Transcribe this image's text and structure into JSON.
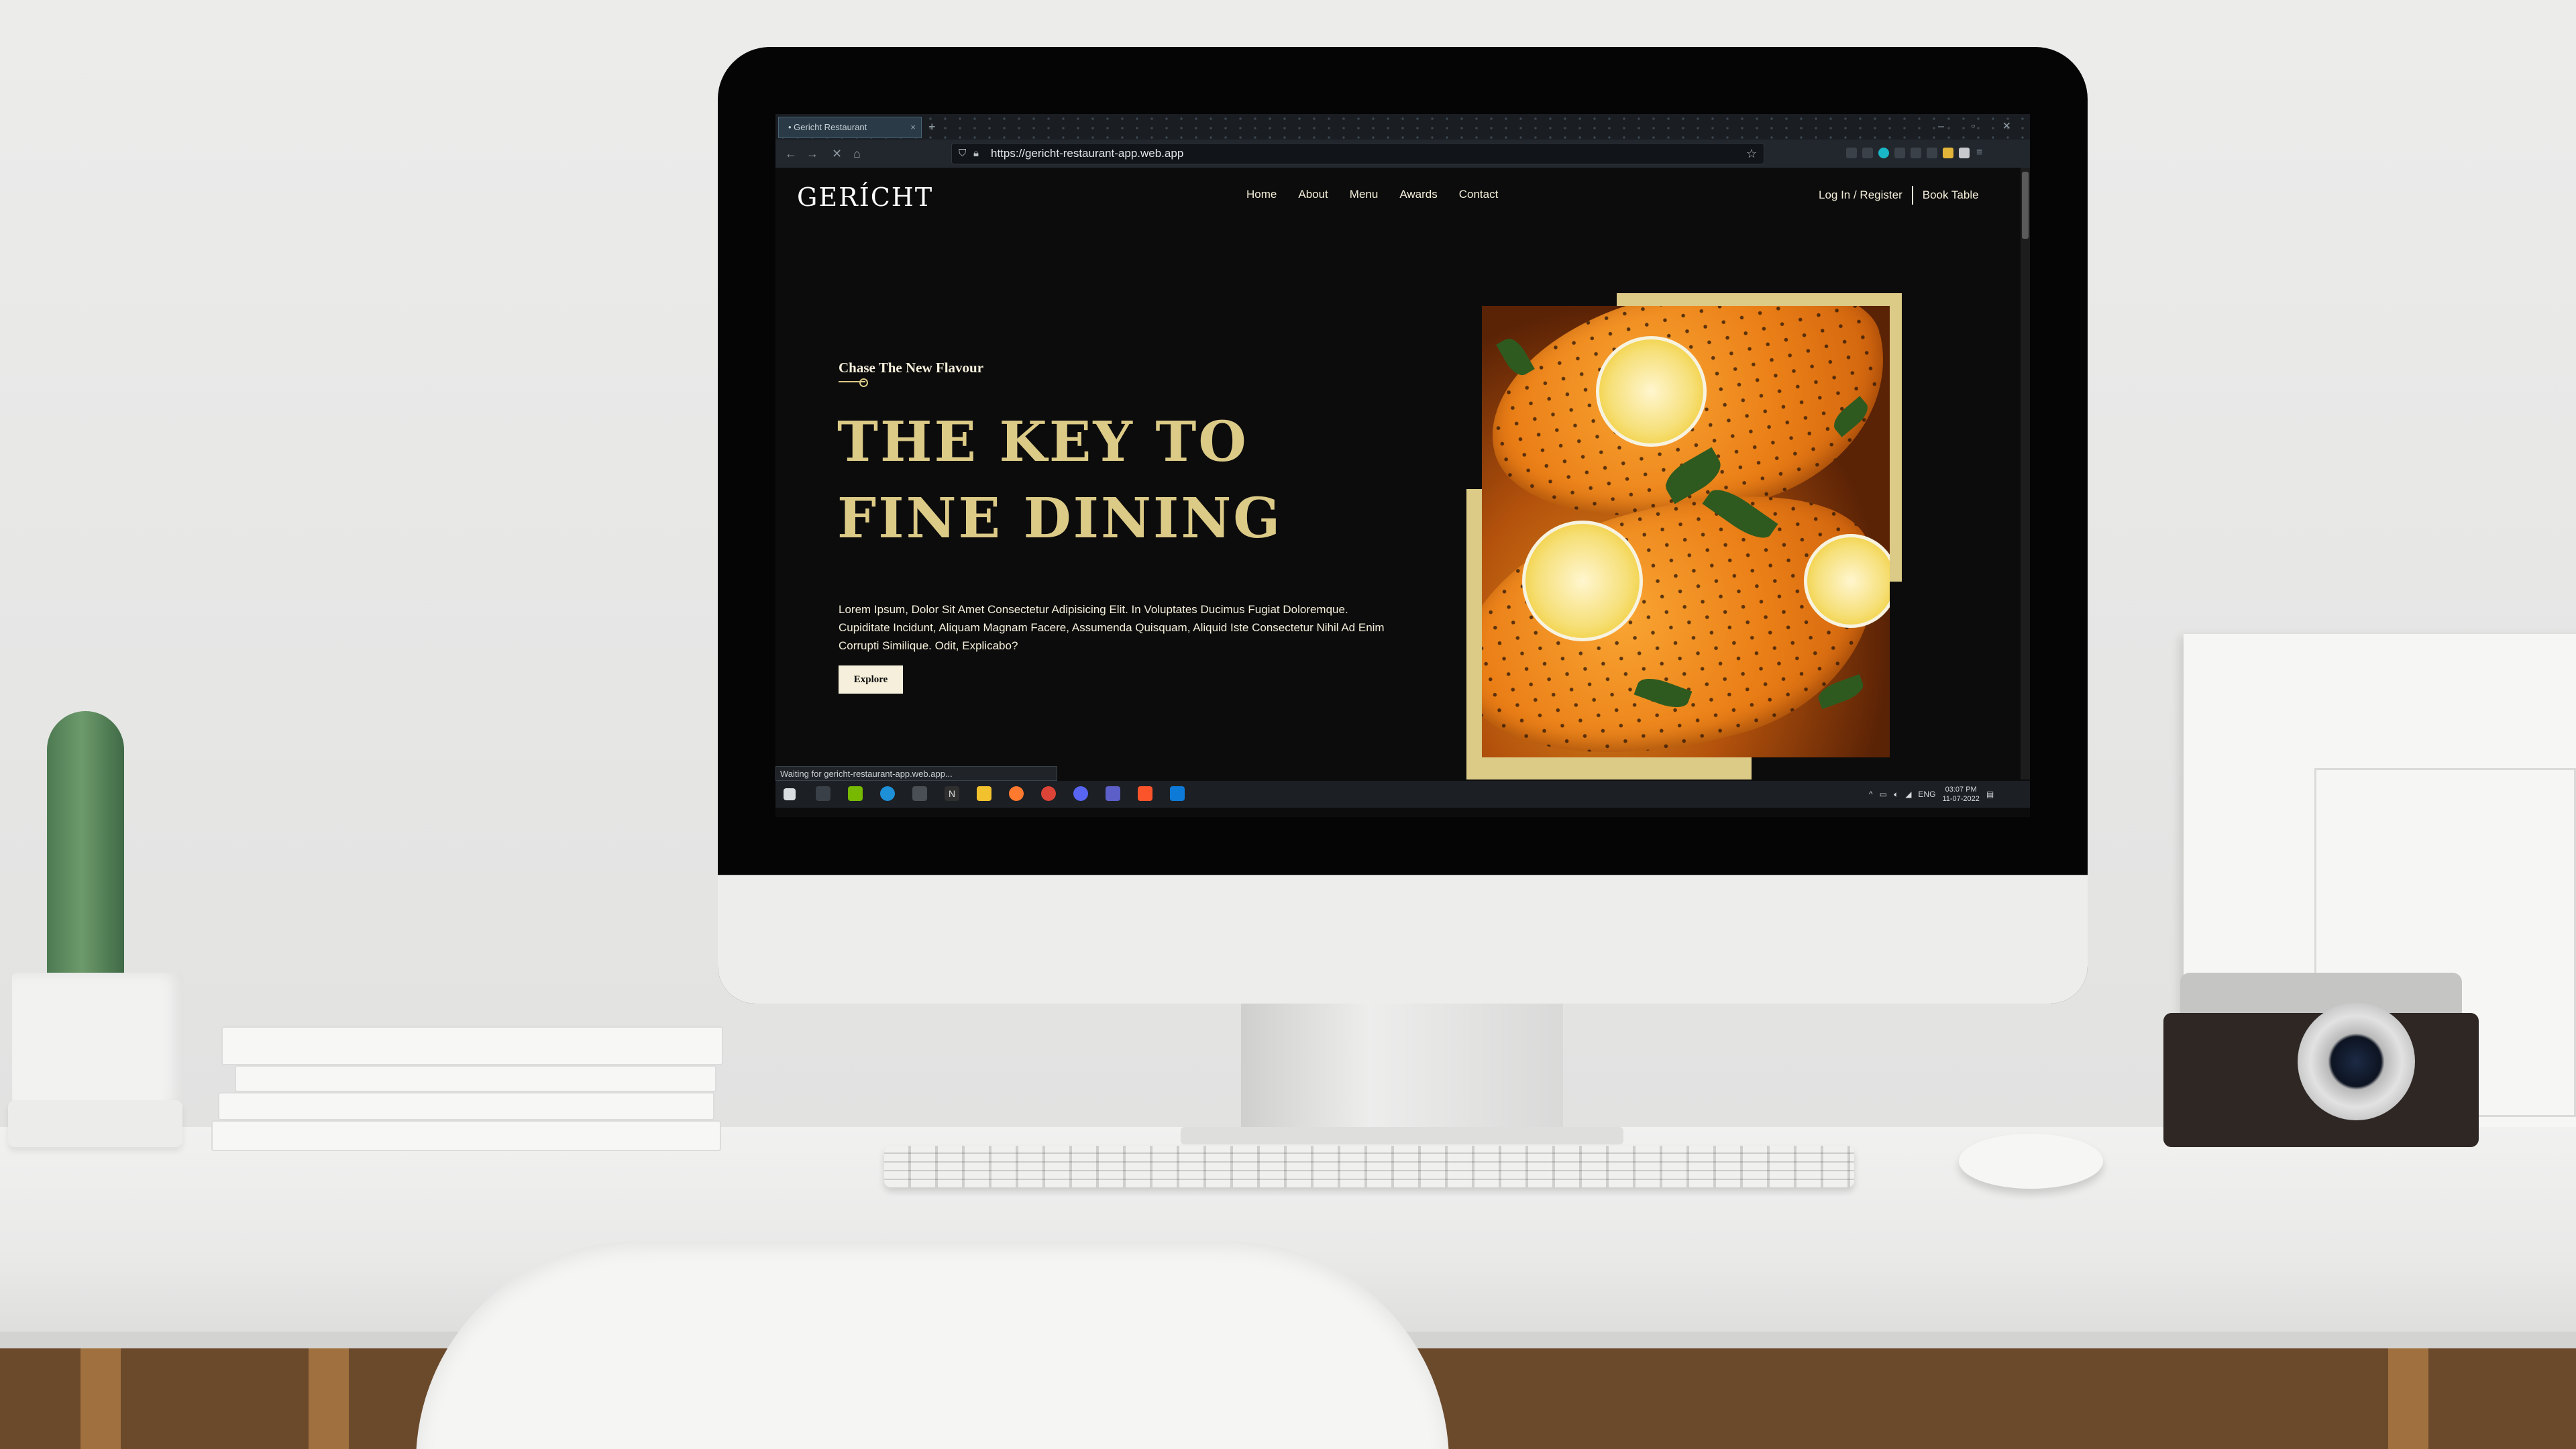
{
  "browser": {
    "tab_title": "• Gericht Restaurant",
    "tab_close": "×",
    "new_tab": "+",
    "window_controls": "– ▫ ✕",
    "nav": {
      "back": "←",
      "forward": "→",
      "stop": "✕",
      "home": "⌂"
    },
    "url": "https://gericht-restaurant-app.web.app",
    "status_text": "Waiting for gericht-restaurant-app.web.app..."
  },
  "site": {
    "logo": "GERÍCHT",
    "menu": [
      "Home",
      "About",
      "Menu",
      "Awards",
      "Contact"
    ],
    "login": "Log In / Register",
    "book": "Book Table",
    "subtitle": "Chase The New Flavour",
    "headline": "THE KEY TO FINE DINING",
    "paragraph": "Lorem Ipsum, Dolor Sit Amet Consectetur Adipisicing Elit. In Voluptates Ducimus Fugiat Doloremque. Cupiditate Incidunt, Aliquam Magnam Facere, Assumenda Quisquam, Aliquid Iste Consectetur Nihil Ad Enim Corrupti Similique. Odit, Explicabo?",
    "explore_button": "Explore",
    "colors": {
      "gold": "#dcca87",
      "cream": "#f5efdb",
      "background": "#0c0c0c"
    }
  },
  "taskbar": {
    "tray_chevron": "^",
    "language": "ENG",
    "time": "03:07 PM",
    "date": "11-07-2022"
  }
}
